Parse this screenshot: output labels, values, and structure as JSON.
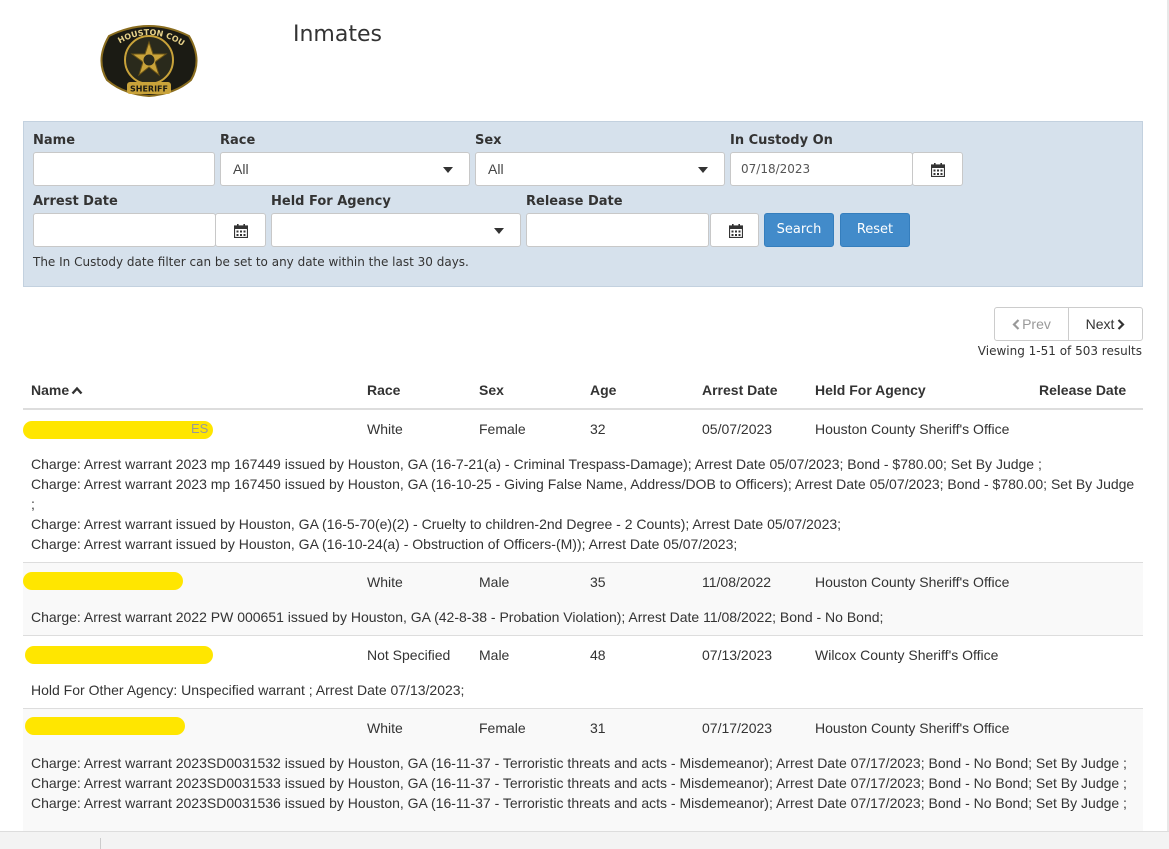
{
  "header": {
    "title": "Inmates",
    "logo": {
      "icon": "sheriff-badge-icon",
      "top_text": "HOUSTON COUNTY",
      "bottom_text": "SHERIFF"
    }
  },
  "filters": {
    "name_label": "Name",
    "name_value": "",
    "race_label": "Race",
    "race_value": "All",
    "sex_label": "Sex",
    "sex_value": "All",
    "custody_label": "In Custody On",
    "custody_value": "07/18/2023",
    "arrest_label": "Arrest Date",
    "arrest_value": "",
    "agency_label": "Held For Agency",
    "agency_value": "",
    "release_label": "Release Date",
    "release_value": "",
    "search_label": "Search",
    "reset_label": "Reset",
    "hint": "The In Custody date filter can be set to any date within the last 30 days."
  },
  "pager": {
    "prev": "Prev",
    "next": "Next",
    "viewing": "Viewing 1-51 of 503 results"
  },
  "table": {
    "headers": [
      "Name",
      "Race",
      "Sex",
      "Age",
      "Arrest Date",
      "Held For Agency",
      "Release Date"
    ],
    "rows": [
      {
        "name_visible": "ES",
        "race": "White",
        "sex": "Female",
        "age": "32",
        "arrest_date": "05/07/2023",
        "agency": "Houston County Sheriff's Office",
        "release_date": "",
        "charges": [
          "Charge: Arrest warrant 2023 mp 167449 issued by Houston, GA (16-7-21(a) - Criminal Trespass-Damage); Arrest Date 05/07/2023; Bond - $780.00; Set By Judge ;",
          "Charge: Arrest warrant 2023 mp 167450 issued by Houston, GA (16-10-25 - Giving False Name, Address/DOB to Officers); Arrest Date 05/07/2023; Bond - $780.00; Set By Judge ;",
          "Charge: Arrest warrant issued by Houston, GA (16-5-70(e)(2) - Cruelty to children-2nd Degree - 2 Counts); Arrest Date 05/07/2023;",
          "Charge: Arrest warrant issued by Houston, GA (16-10-24(a) - Obstruction of Officers-(M)); Arrest Date 05/07/2023;"
        ]
      },
      {
        "name_visible": "",
        "race": "White",
        "sex": "Male",
        "age": "35",
        "arrest_date": "11/08/2022",
        "agency": "Houston County Sheriff's Office",
        "release_date": "",
        "charges": [
          "Charge: Arrest warrant 2022 PW 000651 issued by Houston, GA (42-8-38 - Probation Violation); Arrest Date 11/08/2022; Bond - No Bond;"
        ]
      },
      {
        "name_visible": "",
        "race": "Not Specified",
        "sex": "Male",
        "age": "48",
        "arrest_date": "07/13/2023",
        "agency": "Wilcox County Sheriff's Office",
        "release_date": "",
        "charges": [
          "Hold For Other Agency: Unspecified warrant ; Arrest Date 07/13/2023;"
        ]
      },
      {
        "name_visible": "",
        "race": "White",
        "sex": "Female",
        "age": "31",
        "arrest_date": "07/17/2023",
        "agency": "Houston County Sheriff's Office",
        "release_date": "",
        "charges": [
          "Charge: Arrest warrant 2023SD0031532 issued by Houston, GA (16-11-37 - Terroristic threats and acts - Misdemeanor); Arrest Date 07/17/2023; Bond - No Bond; Set By Judge ;",
          "Charge: Arrest warrant 2023SD0031533 issued by Houston, GA (16-11-37 - Terroristic threats and acts - Misdemeanor); Arrest Date 07/17/2023; Bond - No Bond; Set By Judge ;",
          "Charge: Arrest warrant 2023SD0031536 issued by Houston, GA (16-11-37 - Terroristic threats and acts - Misdemeanor); Arrest Date 07/17/2023; Bond - No Bond; Set By Judge ;"
        ]
      }
    ]
  },
  "colors": {
    "panel": "#d6e1ec",
    "primary": "#428bca",
    "redaction": "#ffe600"
  }
}
